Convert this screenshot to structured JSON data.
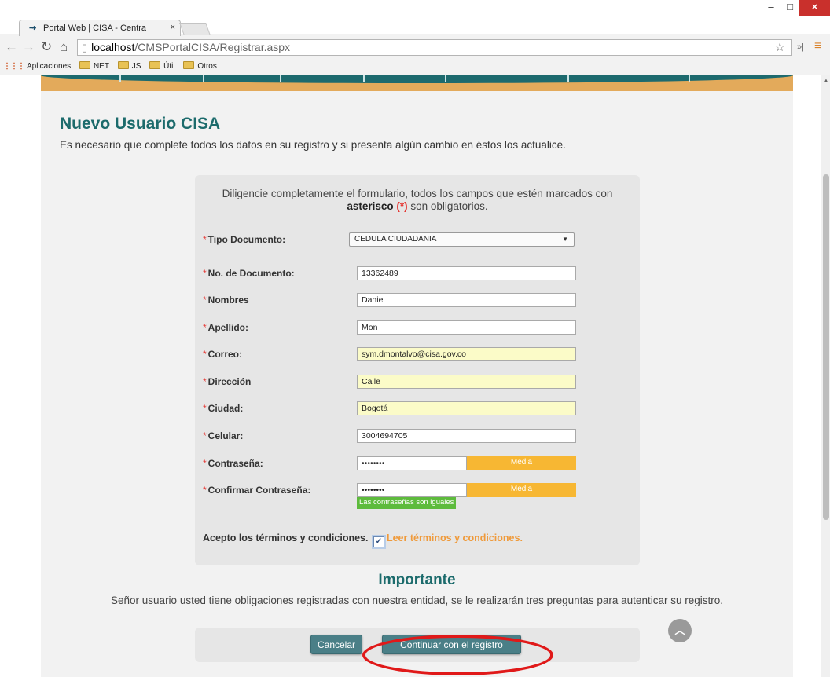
{
  "browser": {
    "tab_title": "Portal Web | CISA - Centra",
    "tab_close": "×",
    "url_host": "localhost",
    "url_path": "/CMSPortalCISA/Registrar.aspx",
    "window_controls": {
      "minimize": "–",
      "maximize": "□",
      "close": "×"
    },
    "bookmarks": [
      "Aplicaciones",
      "NET",
      "JS",
      "Útil",
      "Otros"
    ]
  },
  "page": {
    "title": "Nuevo Usuario CISA",
    "subtitle": "Es necesario que complete todos los datos en su registro y si presenta algún cambio en éstos los actualice.",
    "intro_prefix": "Diligencie completamente el formulario, todos los campos que estén marcados con ",
    "intro_bold": "asterisco",
    "intro_mark": "(*)",
    "intro_suffix": " son obligatorios.",
    "fields": {
      "tipo_documento": {
        "label": "Tipo Documento:",
        "value": "CEDULA CIUDADANIA"
      },
      "no_documento": {
        "label": "No. de Documento:",
        "value": "13362489"
      },
      "nombres": {
        "label": "Nombres",
        "value": "Daniel"
      },
      "apellido": {
        "label": "Apellido:",
        "value": "Mon"
      },
      "correo": {
        "label": "Correo:",
        "value": "sym.dmontalvo@cisa.gov.co"
      },
      "direccion": {
        "label": "Dirección",
        "value": "Calle"
      },
      "ciudad": {
        "label": "Ciudad:",
        "value": "Bogotá"
      },
      "celular": {
        "label": "Celular:",
        "value": "3004694705"
      },
      "contrasena": {
        "label": "Contraseña:",
        "value": "••••••••",
        "strength": "Media"
      },
      "confirmar": {
        "label": "Confirmar Contraseña:",
        "value": "••••••••",
        "strength": "Media",
        "match_message": "Las contraseñas son iguales"
      }
    },
    "required_mark": "*",
    "terms_label": "Acepto los términos y condiciones.",
    "terms_checked": true,
    "terms_link": "Leer términos y condiciones.",
    "important_title": "Importante",
    "important_text": "Señor usuario usted tiene obligaciones registradas con nuestra entidad, se le realizarán tres preguntas para autenticar su registro.",
    "cancel_label": "Cancelar",
    "continue_label": "Continuar con el registro"
  },
  "colors": {
    "accent": "#1c6b6c",
    "button": "#4a7f87",
    "required": "#e53935",
    "strength_medium": "#f7b733",
    "match_ok": "#5dbb3c",
    "highlight": "#e01919"
  }
}
